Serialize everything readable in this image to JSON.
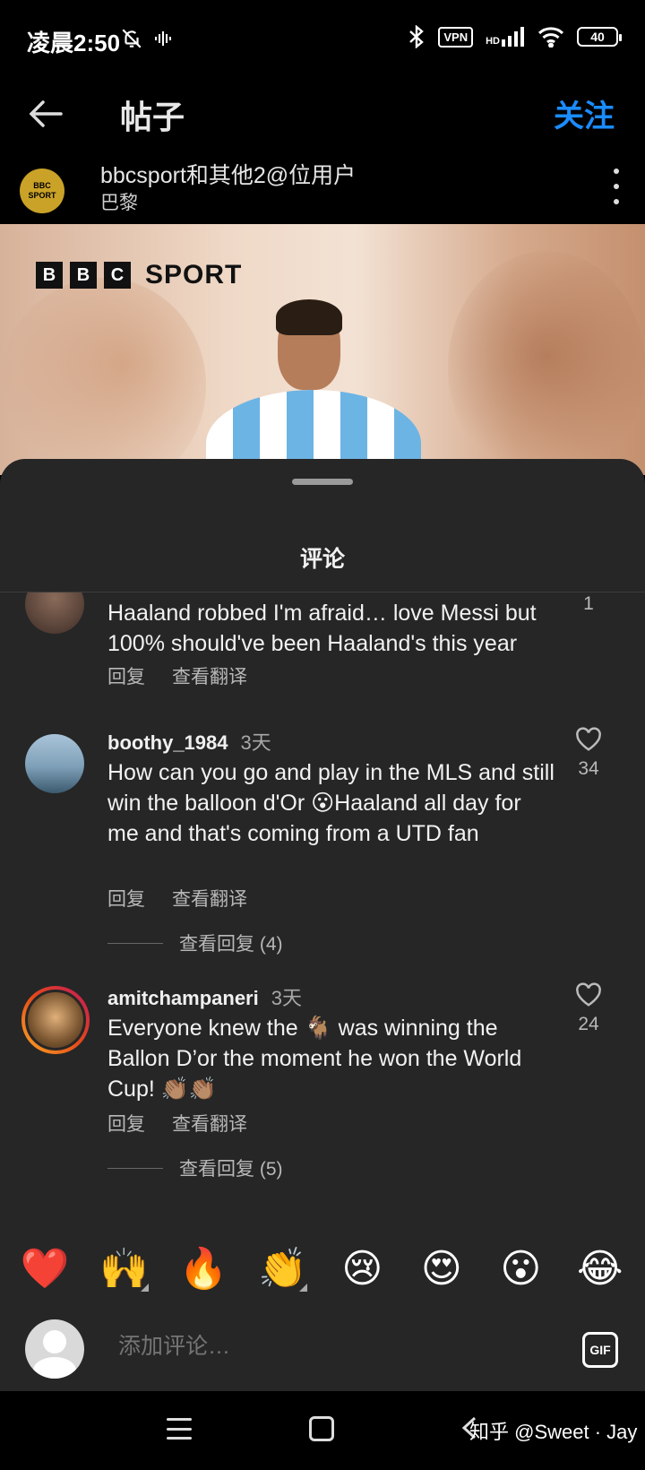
{
  "status_bar": {
    "time": "凌晨2:50",
    "vpn": "VPN",
    "network": "HD",
    "battery": "40"
  },
  "header": {
    "title": "帖子",
    "follow_label": "关注"
  },
  "post": {
    "user": "bbcsport和其他2@位用户",
    "location": "巴黎",
    "avatar_text_line1": "BBC",
    "avatar_text_line2": "SPORT",
    "image_logo": {
      "b1": "B",
      "b2": "B",
      "c": "C",
      "sport": "SPORT"
    }
  },
  "sheet": {
    "title": "评论"
  },
  "comments": [
    {
      "username": "",
      "time": "",
      "text": "Haaland robbed I'm afraid… love Messi but 100% should've been Haaland's this year",
      "reply_label": "回复",
      "translate_label": "查看翻译",
      "likes": "1"
    },
    {
      "username": "boothy_1984",
      "time": "3天",
      "text": "How can you go and play in the MLS and still win the balloon d'Or 😮Haaland all day for me and that's coming from a UTD fan",
      "reply_label": "回复",
      "translate_label": "查看翻译",
      "likes": "34",
      "view_replies": "查看回复 (4)"
    },
    {
      "username": "amitchampaneri",
      "time": "3天",
      "text": "Everyone knew the 🐐 was winning the Ballon D’or the moment he won the World Cup! 👏🏽👏🏽",
      "reply_label": "回复",
      "translate_label": "查看翻译",
      "likes": "24",
      "view_replies": "查看回复 (5)"
    }
  ],
  "emojis": [
    "❤️",
    "🙌",
    "🔥",
    "👏",
    "😢",
    "😍",
    "😮",
    "😂"
  ],
  "composer": {
    "placeholder": "添加评论…",
    "gif_label": "GIF"
  },
  "watermark": "知乎 @Sweet · Jay",
  "colors": {
    "accent": "#1a8cff",
    "sheet_bg": "#262626",
    "story_ring_start": "#f9a825",
    "story_ring_end": "#c2185b"
  }
}
